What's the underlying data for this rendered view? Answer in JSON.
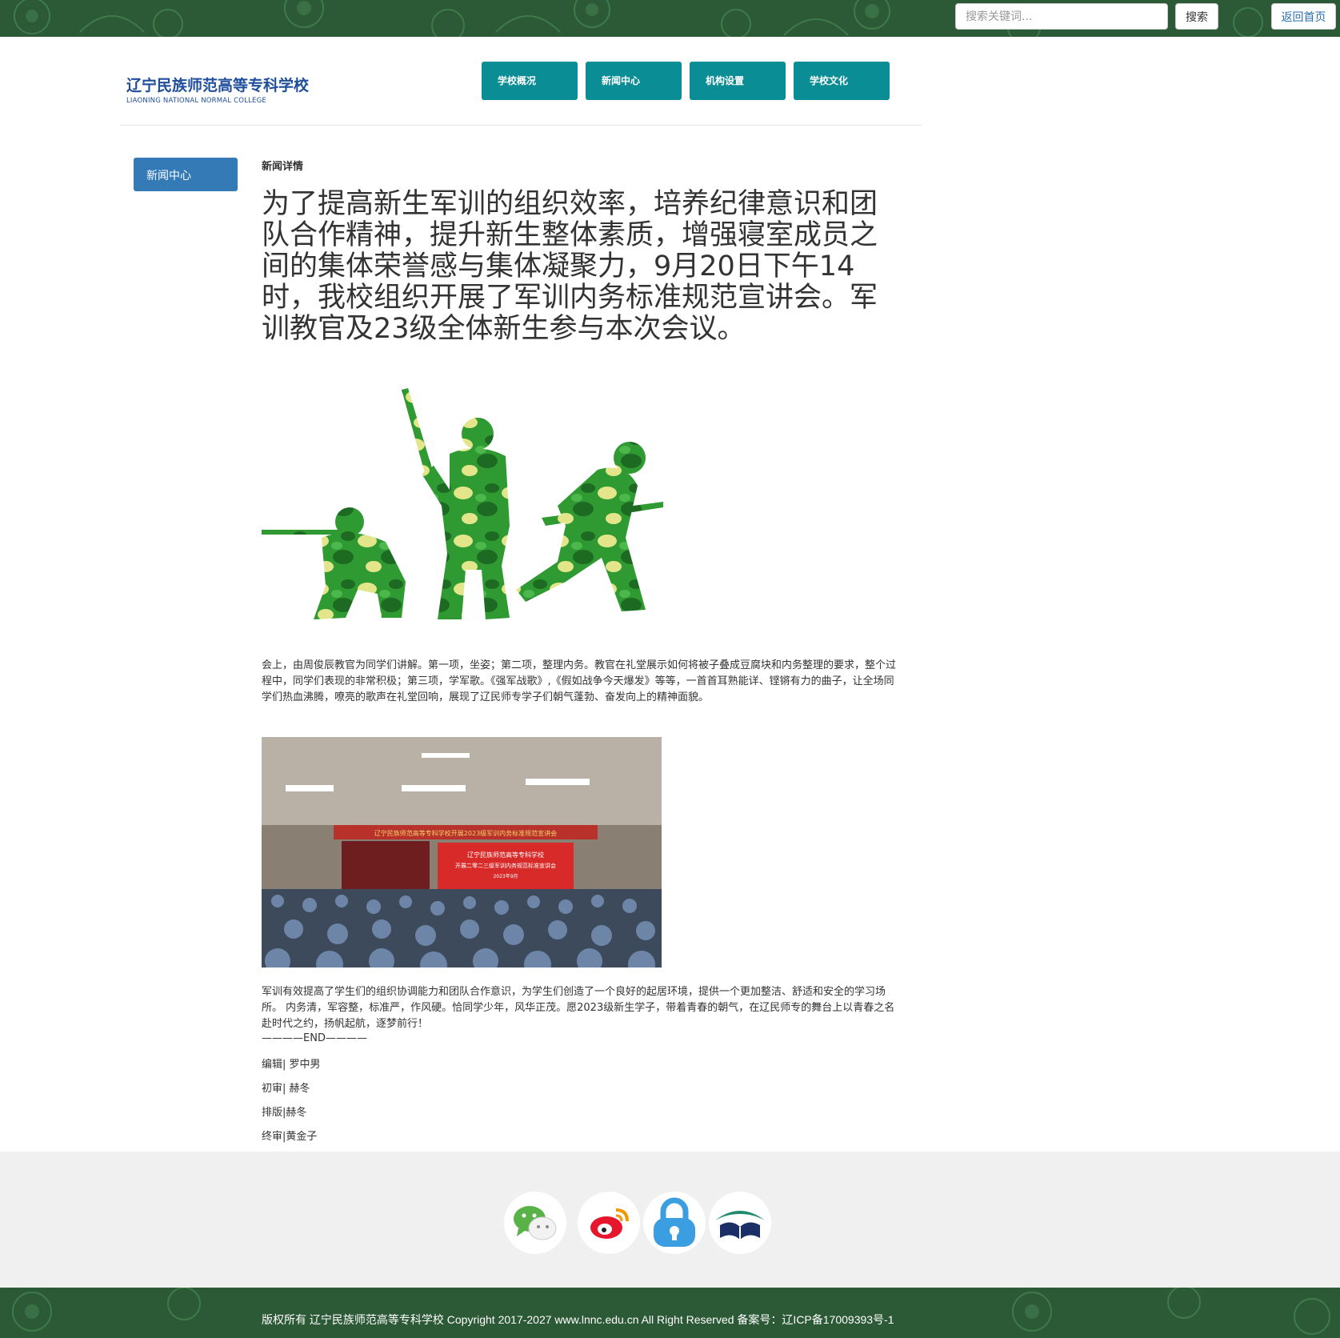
{
  "top": {
    "search_placeholder": "搜索关键词...",
    "search_button": "搜索",
    "home_link": "返回首页"
  },
  "header": {
    "logo_cn": "辽宁民族师范高等专科学校",
    "logo_en": "LIAONING NATIONAL NORMAL COLLEGE",
    "nav": [
      "学校概况",
      "新闻中心",
      "机构设置",
      "学校文化"
    ]
  },
  "sidebar": {
    "active": "新闻中心"
  },
  "article": {
    "breadcrumb": "新闻详情",
    "title": "为了提高新生军训的组织效率，培养纪律意识和团队合作精神，提升新生整体素质，增强寝室成员之间的集体荣誉感与集体凝聚力，9月20日下午14时，我校组织开展了军训内务标准规范宣讲会。军训教官及23级全体新生参与本次会议。",
    "para1": "会上，由周俊辰教官为同学们讲解。第一项，坐姿；第二项，整理内务。教官在礼堂展示如何将被子叠成豆腐块和内务整理的要求，整个过程中，同学们表现的非常积极；第三项，学军歌。《强军战歌》,《假如战争今天爆发》等等，一首首耳熟能详、铿锵有力的曲子，让全场同学们热血沸腾，嘹亮的歌声在礼堂回响，展现了辽民师专学子们朝气蓬勃、奋发向上的精神面貌。",
    "photo_banner_top": "辽宁民族师范高等专科学校开展2023级军训内务标准规范宣讲会",
    "photo_screen_line1": "辽宁民族师范高等专科学校",
    "photo_screen_line2": "开展二零二三级军训内务规范标准宣讲会",
    "photo_screen_line3": "2023年9月",
    "para2": "军训有效提高了学生们的组织协调能力和团队合作意识，为学生们创造了一个良好的起居环境，提供一个更加整洁、舒适和安全的学习场所。 内务清，军容整，标准严，作风硬。恰同学少年，风华正茂。愿2023级新生学子，带着青春的朝气，在辽民师专的舞台上以青春之名赴时代之约，扬帆起航，逐梦前行！",
    "end_marker": "————END————",
    "credits": [
      "编辑| 罗中男",
      "初审| 赫冬",
      "排版|赫冬",
      "终审|黄金子"
    ]
  },
  "footer": {
    "icons": [
      "wechat-icon",
      "weibo-icon",
      "lock-icon",
      "library-icon"
    ],
    "copyright": "版权所有 辽宁民族师范高等专科学校 Copyright 2017-2027 www.lnnc.edu.cn All Right Reserved 备案号：辽ICP备17009393号-1"
  },
  "colors": {
    "top_bar": "#2c5a36",
    "nav": "#0b8d95",
    "sidebar_active": "#337ab7",
    "footer_gray": "#f0f0f0"
  }
}
